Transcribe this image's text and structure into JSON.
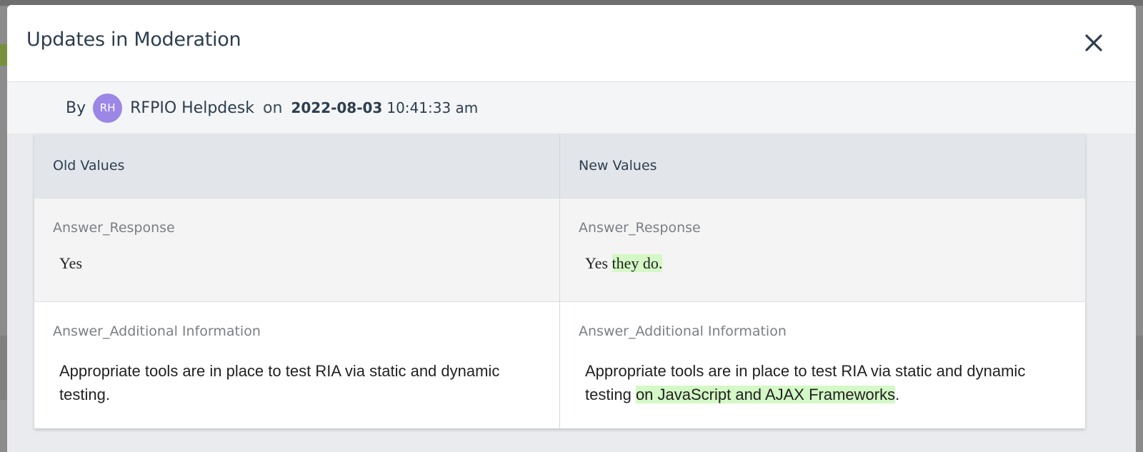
{
  "modal": {
    "title": "Updates in Moderation"
  },
  "byline": {
    "by_label": "By",
    "avatar_initials": "RH",
    "user_name": "RFPIO Helpdesk",
    "on_label": "on",
    "date": "2022-08-03",
    "time": "10:41:33 am"
  },
  "table": {
    "headers": [
      "Old Values",
      "New Values"
    ],
    "rows": [
      {
        "old_label": "Answer_Response",
        "old_value": "Yes",
        "new_label": "Answer_Response",
        "new_value_plain": "Yes ",
        "new_value_added": "they do."
      },
      {
        "old_label": "Answer_Additional Information",
        "old_value": "Appropriate tools are in place to test RIA via static and dynamic testing.",
        "new_label": "Answer_Additional Information",
        "new_value_plain": "Appropriate tools are in place to test RIA via static and dynamic testing ",
        "new_value_added": "on JavaScript and AJAX Frameworks",
        "new_value_tail": "."
      }
    ]
  },
  "colors": {
    "avatar": "#9c86e6",
    "added_highlight": "#d4f8c6",
    "title_text": "#2c3e50"
  }
}
